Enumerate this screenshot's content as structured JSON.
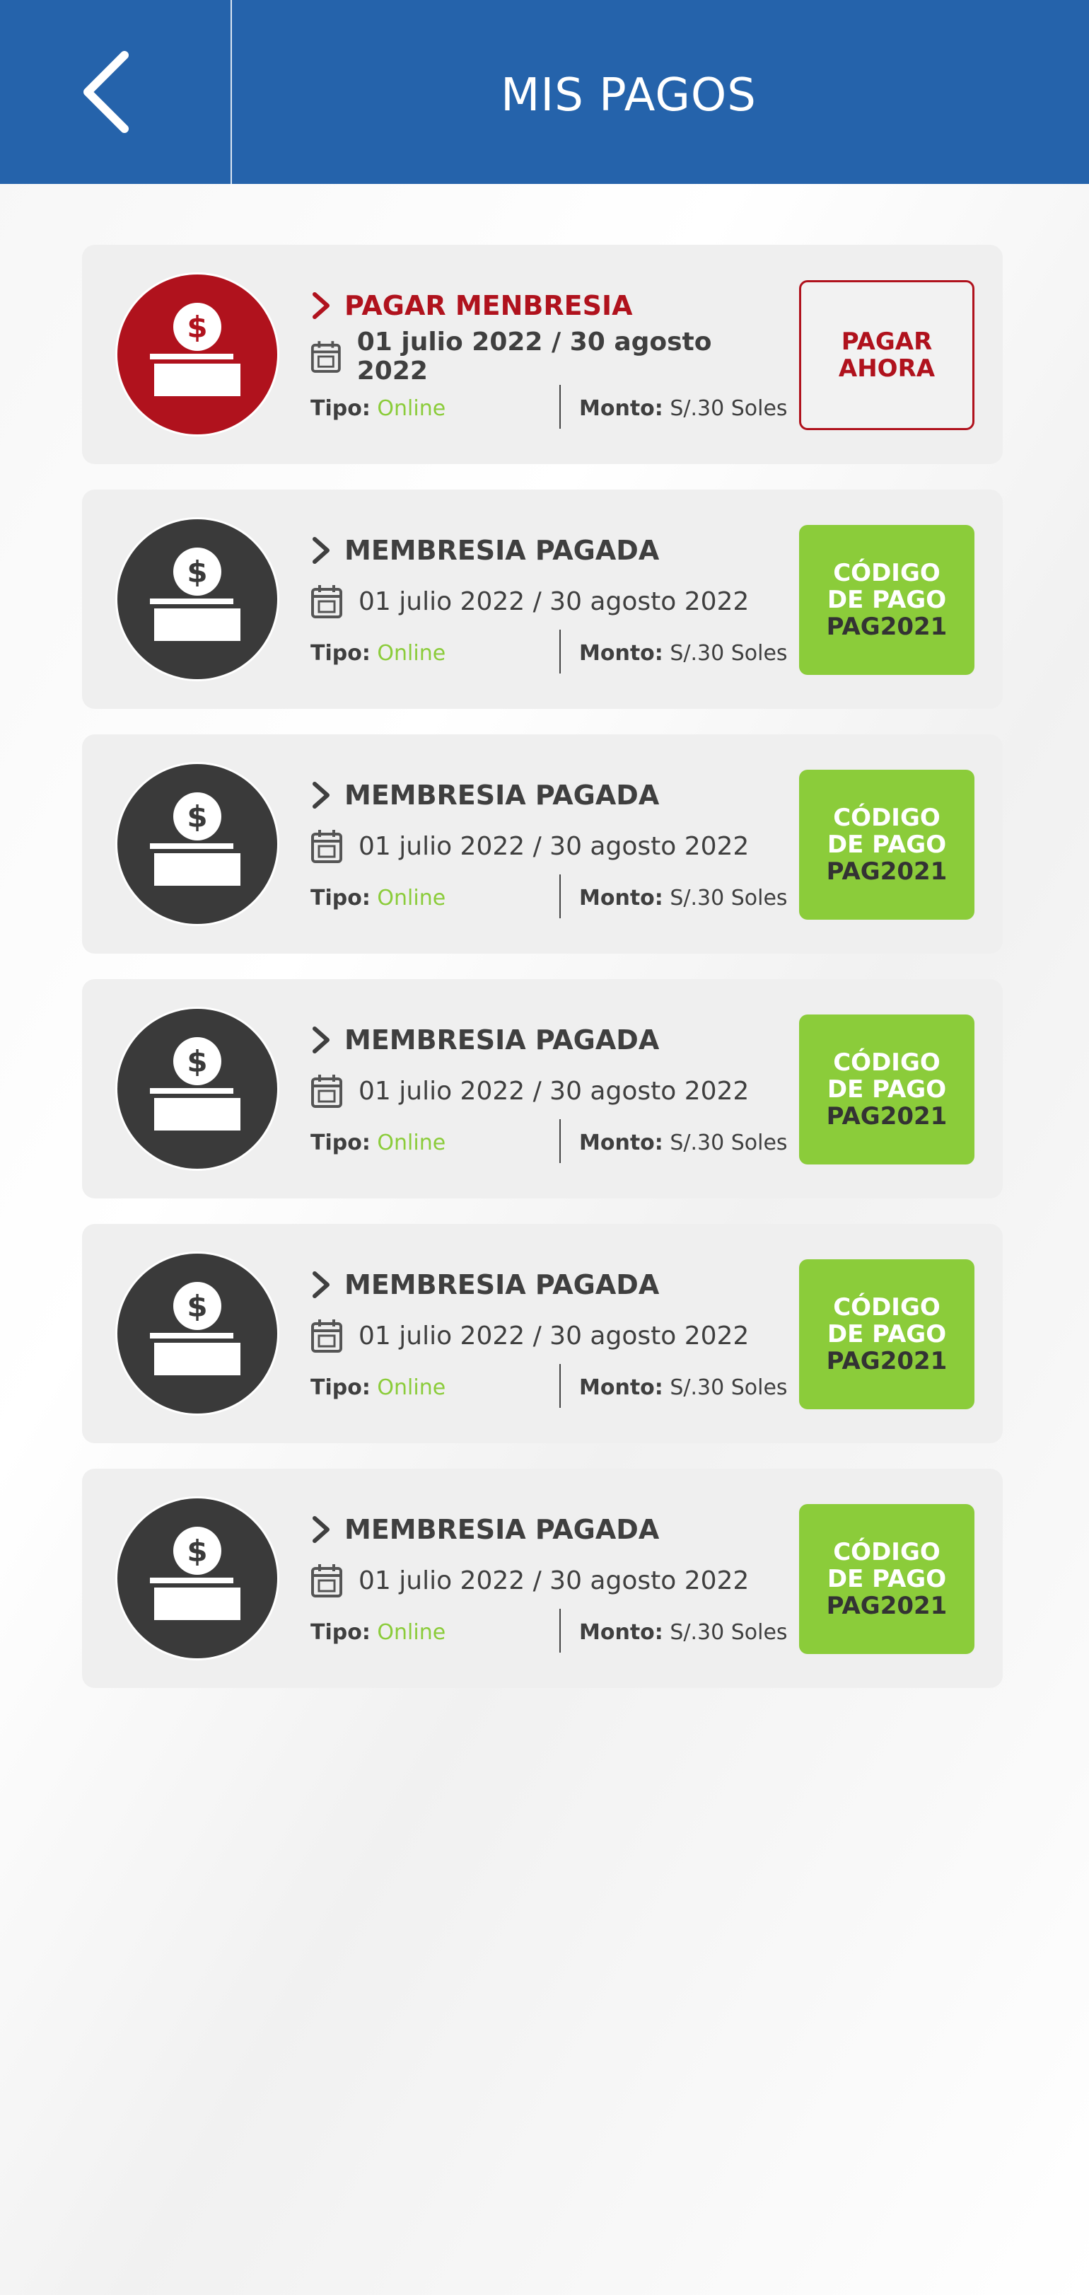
{
  "header": {
    "title": "MIS PAGOS",
    "back_icon": "chevron-left-icon"
  },
  "colors": {
    "header_bg": "#2563ab",
    "pending": "#b0121d",
    "paid_badge": "#8bcc3a",
    "online": "#8bcc3a"
  },
  "payments": [
    {
      "status": "PAGAR MENBRESIA",
      "state": "pending",
      "dates": "01 julio 2022 / 30 agosto 2022",
      "tipo_label": "Tipo:",
      "tipo_value": "Online",
      "monto_label": "Monto:",
      "monto_value": "S/.30 Soles",
      "action": {
        "line1": "PAGAR",
        "line2": "AHORA",
        "line3": ""
      }
    },
    {
      "status": "MEMBRESIA PAGADA",
      "state": "paid",
      "dates": "01 julio 2022 / 30 agosto 2022",
      "tipo_label": "Tipo:",
      "tipo_value": "Online",
      "monto_label": "Monto:",
      "monto_value": "S/.30 Soles",
      "action": {
        "line1": "CÓDIGO",
        "line2": "DE PAGO",
        "line3": "PAG2021"
      }
    },
    {
      "status": "MEMBRESIA PAGADA",
      "state": "paid",
      "dates": "01 julio 2022 / 30 agosto 2022",
      "tipo_label": "Tipo:",
      "tipo_value": "Online",
      "monto_label": "Monto:",
      "monto_value": "S/.30 Soles",
      "action": {
        "line1": "CÓDIGO",
        "line2": "DE PAGO",
        "line3": "PAG2021"
      }
    },
    {
      "status": "MEMBRESIA PAGADA",
      "state": "paid",
      "dates": "01 julio 2022 / 30 agosto 2022",
      "tipo_label": "Tipo:",
      "tipo_value": "Online",
      "monto_label": "Monto:",
      "monto_value": "S/.30 Soles",
      "action": {
        "line1": "CÓDIGO",
        "line2": "DE PAGO",
        "line3": "PAG2021"
      }
    },
    {
      "status": "MEMBRESIA PAGADA",
      "state": "paid",
      "dates": "01 julio 2022 / 30 agosto 2022",
      "tipo_label": "Tipo:",
      "tipo_value": "Online",
      "monto_label": "Monto:",
      "monto_value": "S/.30 Soles",
      "action": {
        "line1": "CÓDIGO",
        "line2": "DE PAGO",
        "line3": "PAG2021"
      }
    },
    {
      "status": "MEMBRESIA PAGADA",
      "state": "paid",
      "dates": "01 julio 2022 / 30 agosto 2022",
      "tipo_label": "Tipo:",
      "tipo_value": "Online",
      "monto_label": "Monto:",
      "monto_value": "S/.30 Soles",
      "action": {
        "line1": "CÓDIGO",
        "line2": "DE PAGO",
        "line3": "PAG2021"
      }
    }
  ]
}
